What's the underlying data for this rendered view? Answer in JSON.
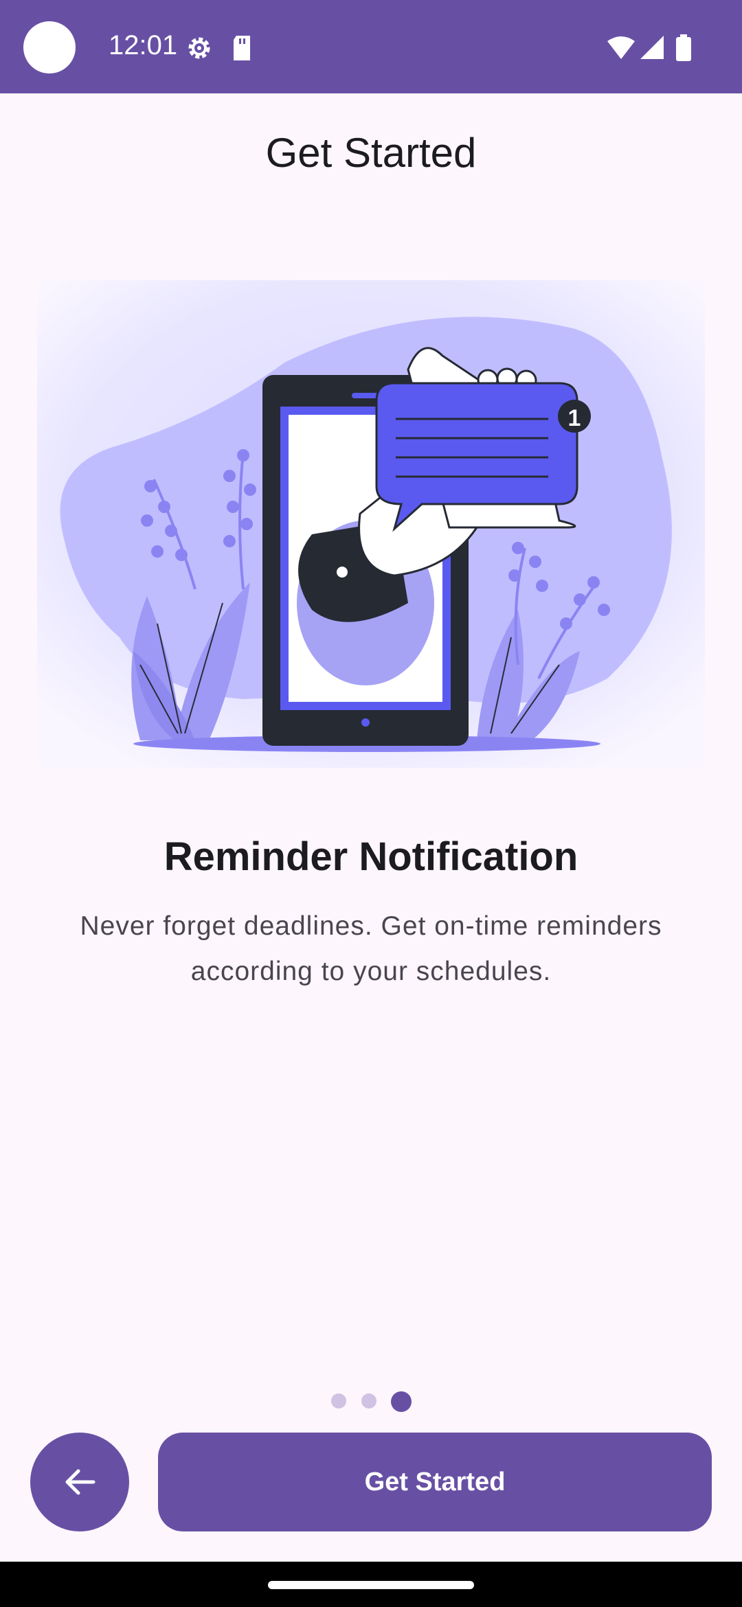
{
  "status_bar": {
    "time": "12:01",
    "icons": [
      "camera-cutout",
      "settings-gear-icon",
      "sd-card-icon",
      "wifi-icon",
      "cell-signal-icon",
      "battery-icon"
    ],
    "background_color": "#6750a4"
  },
  "header": {
    "title": "Get Started"
  },
  "illustration": {
    "subject": "phone-with-hand-holding-notification-bubble"
  },
  "content": {
    "heading": "Reminder Notification",
    "description": "Never forget deadlines. Get on-time reminders according to your schedules."
  },
  "pager": {
    "total": 3,
    "active_index": 2
  },
  "footer": {
    "back_icon": "arrow-left-icon",
    "primary_label": "Get Started"
  },
  "colors": {
    "accent": "#6750a4",
    "background": "#fdf6fd",
    "illustration_accent": "#5a5af0"
  }
}
